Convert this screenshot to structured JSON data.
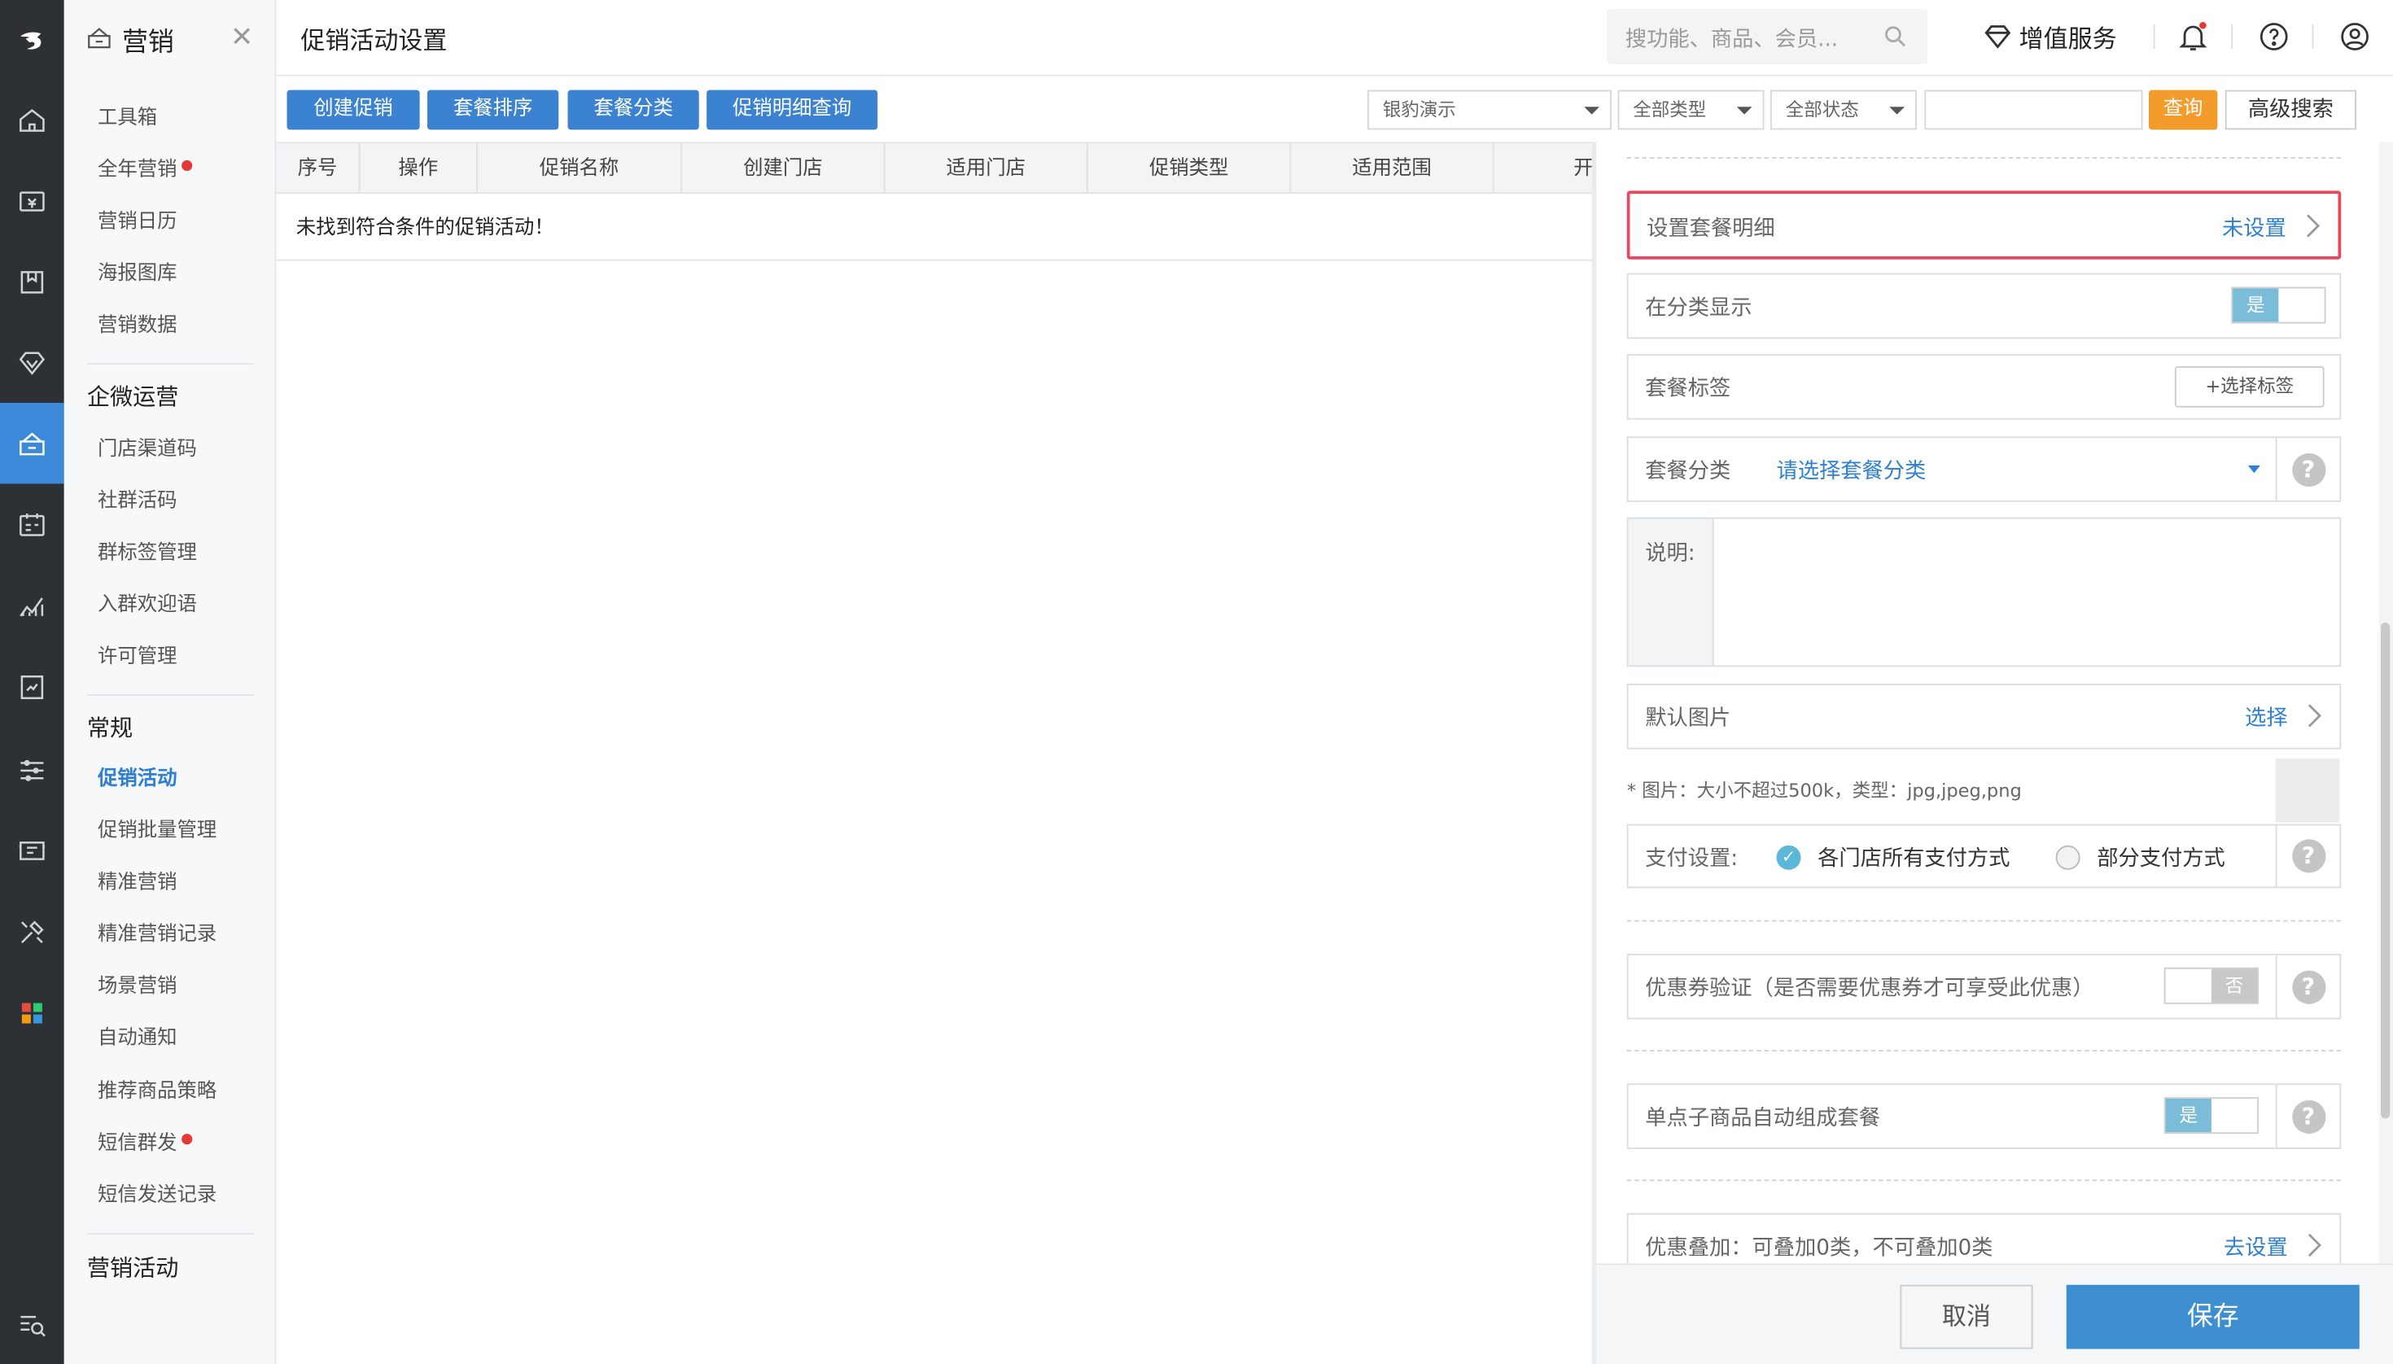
{
  "sidebar_icons": [
    "logo-icon",
    "home-icon",
    "cashier-icon",
    "box-icon",
    "diamond-icon",
    "marketing-icon",
    "member-card-icon",
    "chart-icon",
    "report-icon",
    "settings-sliders-icon",
    "screen-icon",
    "tools-icon",
    "apps-icon",
    "search-menu-icon"
  ],
  "submenu": {
    "title": "营销",
    "items": [
      {
        "label": "工具箱"
      },
      {
        "label": "全年营销",
        "dot": true
      },
      {
        "label": "营销日历"
      },
      {
        "label": "海报图库"
      },
      {
        "label": "营销数据"
      }
    ],
    "group1": "企微运营",
    "group1_items": [
      {
        "label": "门店渠道码"
      },
      {
        "label": "社群活码"
      },
      {
        "label": "群标签管理"
      },
      {
        "label": "入群欢迎语"
      },
      {
        "label": "许可管理"
      }
    ],
    "group2": "常规",
    "group2_items": [
      {
        "label": "促销活动",
        "active": true
      },
      {
        "label": "促销批量管理"
      },
      {
        "label": "精准营销"
      },
      {
        "label": "精准营销记录"
      },
      {
        "label": "场景营销"
      },
      {
        "label": "自动通知"
      },
      {
        "label": "推荐商品策略"
      },
      {
        "label": "短信群发",
        "dot": true
      },
      {
        "label": "短信发送记录"
      }
    ],
    "group3": "营销活动"
  },
  "header": {
    "title": "促销活动设置",
    "search_placeholder": "搜功能、商品、会员...",
    "value_service": "增值服务"
  },
  "toolbar": {
    "create": "创建促销",
    "sort": "套餐排序",
    "category": "套餐分类",
    "detail_query": "促销明细查询",
    "store_select": "银豹演示",
    "type_select": "全部类型",
    "status_select": "全部状态",
    "keyword": "",
    "query": "查询",
    "advanced": "高级搜索"
  },
  "table": {
    "columns": [
      "序号",
      "操作",
      "促销名称",
      "创建门店",
      "适用门店",
      "促销类型",
      "适用范围",
      "开"
    ],
    "empty_text": "未找到符合条件的促销活动！"
  },
  "panel": {
    "package_detail_label": "设置套餐明细",
    "package_detail_value": "未设置",
    "show_in_category_label": "在分类显示",
    "show_in_category_toggle": "是",
    "package_tag_label": "套餐标签",
    "package_tag_button": "+选择标签",
    "package_category_label": "套餐分类",
    "package_category_value": "请选择套餐分类",
    "description_label": "说明:",
    "description_value": "",
    "default_image_label": "默认图片",
    "default_image_action": "选择",
    "image_hint": "* 图片：大小不超过500k，类型：jpg,jpeg,png",
    "payment_label": "支付设置:",
    "payment_option_all": "各门店所有支付方式",
    "payment_option_partial": "部分支付方式",
    "payment_selected": "all",
    "coupon_label": "优惠券验证（是否需要优惠券才可享受此优惠）",
    "coupon_toggle": "否",
    "single_item_label": "单点子商品自动组成套餐",
    "single_item_toggle": "是",
    "stack_label": "优惠叠加：可叠加0类，不可叠加0类",
    "stack_action": "去设置",
    "cancel": "取消",
    "save": "保存"
  },
  "colors": {
    "accent": "#3b82d0",
    "query": "#f39c2b",
    "highlight_border": "#e8475f",
    "active_sidebar": "#3b8ad9"
  }
}
